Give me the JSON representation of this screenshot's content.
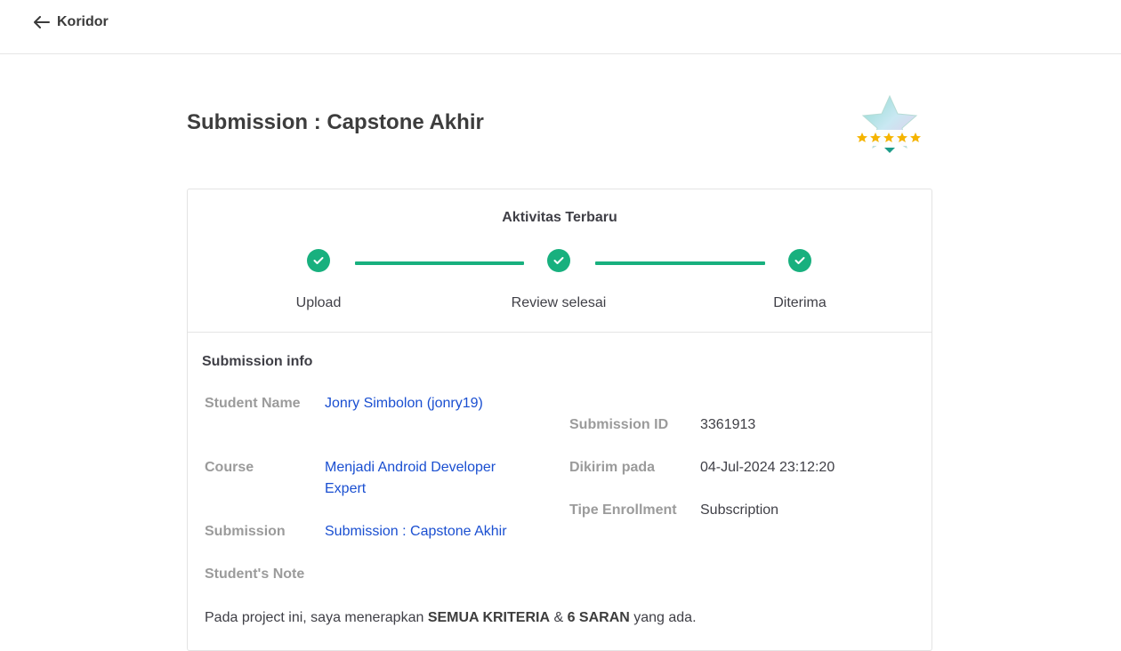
{
  "header": {
    "back_label": "Koridor",
    "back_icon": "arrow-left-icon"
  },
  "page": {
    "title": "Submission : Capstone Akhir",
    "badge_icon": "star-rating-badge-icon",
    "badge_stars": 5
  },
  "activity": {
    "title": "Aktivitas Terbaru",
    "steps": [
      {
        "label": "Upload",
        "status": "done"
      },
      {
        "label": "Review selesai",
        "status": "done"
      },
      {
        "label": "Diterima",
        "status": "done"
      }
    ],
    "accent_color": "#18b07e"
  },
  "info": {
    "title": "Submission info",
    "student_name_label": "Student Name",
    "student_name_value": "Jonry Simbolon (jonry19)",
    "course_label": "Course",
    "course_value": "Menjadi Android Developer Expert",
    "submission_label": "Submission",
    "submission_value": "Submission : Capstone Akhir",
    "note_label": "Student's Note",
    "submission_id_label": "Submission ID",
    "submission_id_value": "3361913",
    "sent_label": "Dikirim pada",
    "sent_value": "04-Jul-2024 23:12:20",
    "enrollment_label": "Tipe Enrollment",
    "enrollment_value": "Subscription",
    "link_color": "#1a4fd1"
  },
  "note": {
    "part1": "Pada project ini, saya menerapkan ",
    "bold1": "SEMUA KRITERIA",
    "part2": " & ",
    "bold2": "6 SARAN",
    "part3": " yang ada."
  }
}
